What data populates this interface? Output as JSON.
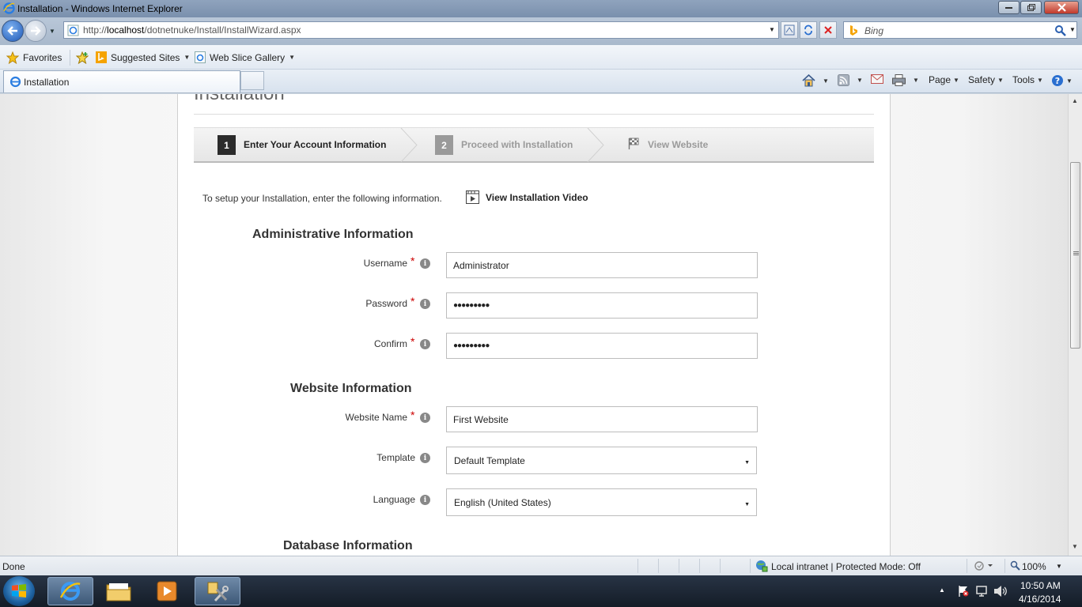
{
  "window": {
    "title": "Installation - Windows Internet Explorer"
  },
  "address": {
    "url_prefix": "http://",
    "url_host": "localhost",
    "url_path": "/dotnetnuke/Install/InstallWizard.aspx"
  },
  "search": {
    "placeholder": "Bing"
  },
  "favorites_bar": {
    "favorites": "Favorites",
    "suggested": "Suggested Sites",
    "webslice": "Web Slice Gallery"
  },
  "tab": {
    "label": "Installation"
  },
  "commandbar": {
    "page": "Page",
    "safety": "Safety",
    "tools": "Tools"
  },
  "page": {
    "cut_title": "Installation"
  },
  "wizard": {
    "steps": [
      {
        "num": "1",
        "label": "Enter Your Account Information"
      },
      {
        "num": "2",
        "label": "Proceed with Installation"
      },
      {
        "label": "View Website"
      }
    ]
  },
  "intro": {
    "text": "To setup your Installation, enter the following information.",
    "video_link": "View Installation Video"
  },
  "admin": {
    "heading": "Administrative Information",
    "username_label": "Username",
    "username_value": "Administrator",
    "password_label": "Password",
    "password_value": "●●●●●●●●●",
    "confirm_label": "Confirm",
    "confirm_value": "●●●●●●●●●"
  },
  "website": {
    "heading": "Website Information",
    "name_label": "Website Name",
    "name_value": "First Website",
    "template_label": "Template",
    "template_value": "Default Template",
    "language_label": "Language",
    "language_value": "English (United States)"
  },
  "database": {
    "heading": "Database Information"
  },
  "statusbar": {
    "left": "Done",
    "zone": "Local intranet | Protected Mode: Off",
    "zoom": "100%"
  },
  "clock": {
    "time": "10:50 AM",
    "date": "4/16/2014"
  },
  "colors": {
    "titlebar": "#7a90ad",
    "step_active": "#2b2b2b",
    "step_inactive": "#9a9a9a",
    "required": "#cc0000"
  }
}
